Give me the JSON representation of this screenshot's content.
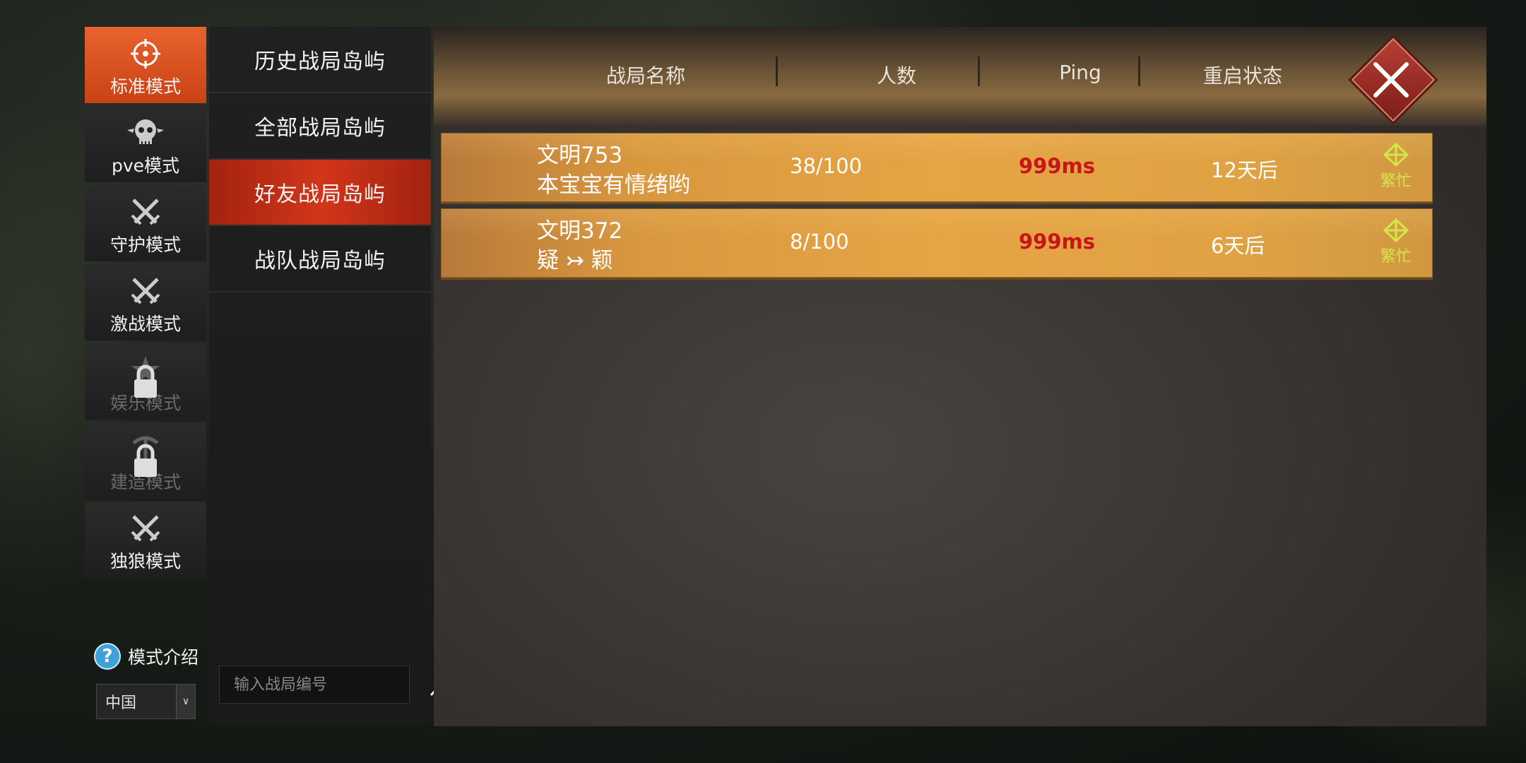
{
  "modes": [
    {
      "label": "标准模式",
      "icon": "crosshair-icon",
      "active": true,
      "locked": false
    },
    {
      "label": "pve模式",
      "icon": "skull-icon",
      "active": false,
      "locked": false
    },
    {
      "label": "守护模式",
      "icon": "crossed-swords-icon",
      "active": false,
      "locked": false
    },
    {
      "label": "激战模式",
      "icon": "crossed-swords-icon",
      "active": false,
      "locked": false
    },
    {
      "label": "娱乐模式",
      "icon": "star-icon",
      "active": false,
      "locked": true
    },
    {
      "label": "建造模式",
      "icon": "pickaxe-icon",
      "active": false,
      "locked": true
    },
    {
      "label": "独狼模式",
      "icon": "crossed-swords-icon",
      "active": false,
      "locked": false
    }
  ],
  "intro": {
    "label": "模式介绍"
  },
  "region": {
    "value": "中国"
  },
  "categories": [
    {
      "label": "历史战局岛屿",
      "active": false
    },
    {
      "label": "全部战局岛屿",
      "active": false
    },
    {
      "label": "好友战局岛屿",
      "active": true
    },
    {
      "label": "战队战局岛屿",
      "active": false
    }
  ],
  "search": {
    "placeholder": "输入战局编号"
  },
  "table": {
    "headers": {
      "name": "战局名称",
      "count": "人数",
      "ping": "Ping",
      "restart": "重启状态"
    },
    "rows": [
      {
        "name": "文明753",
        "owner": "本宝宝有情绪哟",
        "count": "38/100",
        "ping": "999ms",
        "restart": "12天后",
        "status": "繁忙"
      },
      {
        "name": "文明372",
        "owner": "疑 ↣ 颖",
        "count": "8/100",
        "ping": "999ms",
        "restart": "6天后",
        "status": "繁忙"
      }
    ]
  },
  "colors": {
    "accent": "#e8632e",
    "active_category": "#c8321a",
    "ping_bad": "#c8141a",
    "status_busy": "#d4e64a"
  }
}
